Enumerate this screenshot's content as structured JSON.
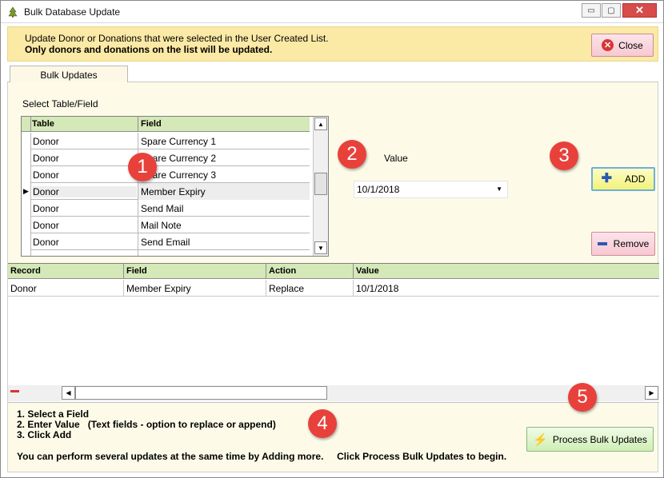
{
  "window": {
    "title": "Bulk Database Update",
    "controls": {
      "minimize": "▭",
      "maximize": "▢",
      "close": "✕"
    }
  },
  "banner": {
    "line1": "Update Donor or Donations that were selected in the User Created List.",
    "line2": "Only donors and donations on the list will be updated.",
    "close_label": "Close"
  },
  "tabs": [
    {
      "label": "Bulk Updates",
      "active": true
    }
  ],
  "select_section": {
    "label": "Select Table/Field"
  },
  "field_grid": {
    "columns": [
      "Table",
      "Field"
    ],
    "rows": [
      {
        "table": "Donor",
        "field": "Spare Currency 1"
      },
      {
        "table": "Donor",
        "field": "Spare Currency 2"
      },
      {
        "table": "Donor",
        "field": "Spare Currency 3"
      },
      {
        "table": "Donor",
        "field": "Member Expiry",
        "selected": true
      },
      {
        "table": "Donor",
        "field": "Send Mail"
      },
      {
        "table": "Donor",
        "field": "Mail Note"
      },
      {
        "table": "Donor",
        "field": "Send Email"
      }
    ]
  },
  "value_section": {
    "label": "Value",
    "value": "10/1/2018"
  },
  "buttons": {
    "add": "ADD",
    "remove": "Remove",
    "process": "Process Bulk Updates"
  },
  "updates_grid": {
    "columns": [
      "Record",
      "Field",
      "Action",
      "Value"
    ],
    "rows": [
      {
        "record": "Donor",
        "field": "Member Expiry",
        "action": "Replace",
        "value": "10/1/2018"
      }
    ]
  },
  "instructions": [
    "1. Select a Field",
    "2. Enter Value   (Text fields - option to replace or append)",
    "3. Click Add"
  ],
  "footer_note": "You can perform several updates at the same time by Adding more.     Click Process Bulk Updates to begin.",
  "markers": [
    "1",
    "2",
    "3",
    "4",
    "5"
  ],
  "colors": {
    "banner_bg": "#fbe9a6",
    "grid_header": "#d5e8b8",
    "marker": "#e8413b",
    "add_button": "#f2f27a",
    "remove_button": "#f7c8d2",
    "process_button": "#cfeeb5"
  },
  "icons": {
    "app": "tree-icon",
    "close_button": "x-circle-icon",
    "add": "plus-icon",
    "remove": "minus-icon",
    "process": "lightning-icon"
  }
}
